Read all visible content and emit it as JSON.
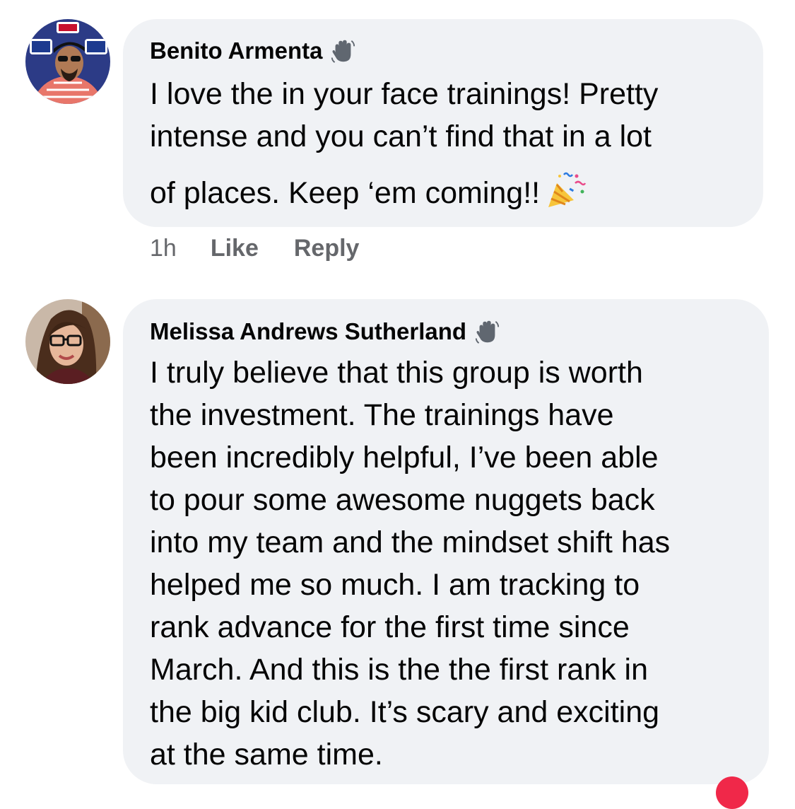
{
  "comments": [
    {
      "author": "Benito Armenta",
      "lines": [
        "I love the in your face trainings!  Pretty",
        "intense and you can’t find that in a lot",
        "of places. Keep ‘em coming!!"
      ],
      "trailing_emoji": "party-popper-icon",
      "badge_icon": "waving-hand-icon",
      "time": "1h",
      "like_label": "Like",
      "reply_label": "Reply"
    },
    {
      "author": "Melissa Andrews Sutherland",
      "lines": [
        "I truly believe that this group is worth",
        "the investment.  The trainings have",
        "been incredibly helpful, I’ve been able",
        "to pour some awesome nuggets back",
        "into my team and the mindset shift has",
        "helped me so much.  I am tracking to",
        "rank advance for the first time since",
        "March.  And this is the the first rank in",
        "the big kid club. It’s scary and exciting",
        "at the same time."
      ],
      "badge_icon": "waving-hand-icon"
    }
  ],
  "colors": {
    "bubble": "#f0f2f5",
    "text": "#050505",
    "meta": "#65676b",
    "notification": "#f02849"
  }
}
